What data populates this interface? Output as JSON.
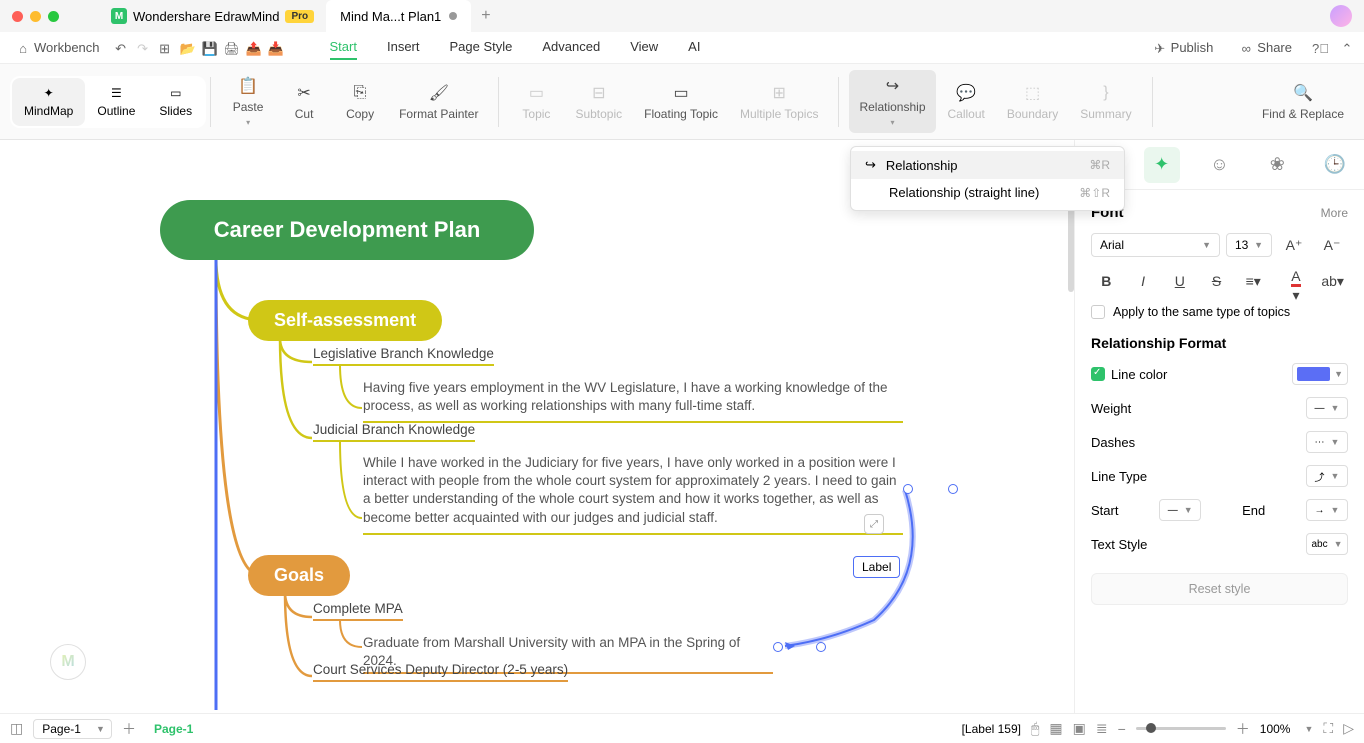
{
  "titlebar": {
    "app_name": "Wondershare EdrawMind",
    "pro": "Pro",
    "file_tab": "Mind Ma...t Plan1",
    "add": "+"
  },
  "menubar": {
    "workbench": "Workbench",
    "tabs": [
      "Start",
      "Insert",
      "Page Style",
      "Advanced",
      "View",
      "AI"
    ],
    "active": 0,
    "publish": "Publish",
    "share": "Share"
  },
  "ribbon": {
    "view": [
      "MindMap",
      "Outline",
      "Slides"
    ],
    "edit": [
      "Paste",
      "Cut",
      "Copy",
      "Format Painter"
    ],
    "topics": [
      "Topic",
      "Subtopic",
      "Floating Topic",
      "Multiple Topics"
    ],
    "insert": [
      "Relationship",
      "Callout",
      "Boundary",
      "Summary"
    ],
    "find": "Find & Replace"
  },
  "dropdown": {
    "item1": "Relationship",
    "sc1": "⌘R",
    "item2": "Relationship (straight line)",
    "sc2": "⌘⇧R"
  },
  "map": {
    "main": "Career Development Plan",
    "self_assessment": "Self-assessment",
    "leg": "Legislative Branch Knowledge",
    "leg_note": "Having five years employment in the WV Legislature, I have a working knowledge of the process, as well as working relationships with many full-time staff.",
    "jud": "Judicial Branch Knowledge",
    "jud_note": "While I have worked in the Judiciary for five years, I have only worked in a position were I interact with people from the whole court system for approximately 2 years.  I need to gain a better understanding of the whole court system and how it works together, as well as become better acquainted with our judges and judicial staff.",
    "goals": "Goals",
    "mpa": "Complete MPA",
    "mpa_note": "Graduate from Marshall University with an MPA in the Spring of 2024.",
    "deputy": "Court Services Deputy Director (2-5 years)",
    "label": "Label"
  },
  "panel": {
    "font_h": "Font",
    "more": "More",
    "font_family": "Arial",
    "font_size": "13",
    "apply": "Apply to the same type of topics",
    "rel_h": "Relationship Format",
    "line_color": "Line color",
    "line_color_val": "#5b6ef5",
    "weight": "Weight",
    "dashes": "Dashes",
    "line_type": "Line Type",
    "start": "Start",
    "end": "End",
    "text_style": "Text Style",
    "reset": "Reset style"
  },
  "status": {
    "page_sel": "Page-1",
    "page_tab": "Page-1",
    "label_info": "[Label 159]",
    "zoom": "100%"
  }
}
